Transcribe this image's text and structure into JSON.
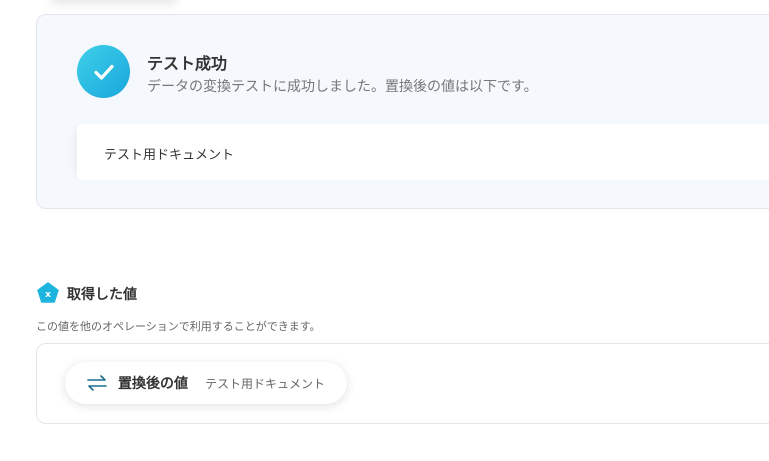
{
  "success": {
    "title": "テスト成功",
    "description": "データの変換テストに成功しました。置換後の値は以下です。",
    "result_value": "テスト用ドキュメント"
  },
  "retrieved": {
    "title": "取得した値",
    "description": "この値を他のオペレーションで利用することができます。",
    "items": [
      {
        "label": "置換後の値",
        "value": "テスト用ドキュメント"
      }
    ]
  },
  "colors": {
    "accent": "#1eb4e0",
    "accent_light": "#3fd0e8",
    "card_bg": "#f5f8fc",
    "border": "#e2e6ec",
    "swap_icon": "#1a6e8e"
  },
  "icons": {
    "success": "check-circle-icon",
    "section": "pentagon-x-icon",
    "value": "swap-arrows-icon"
  }
}
